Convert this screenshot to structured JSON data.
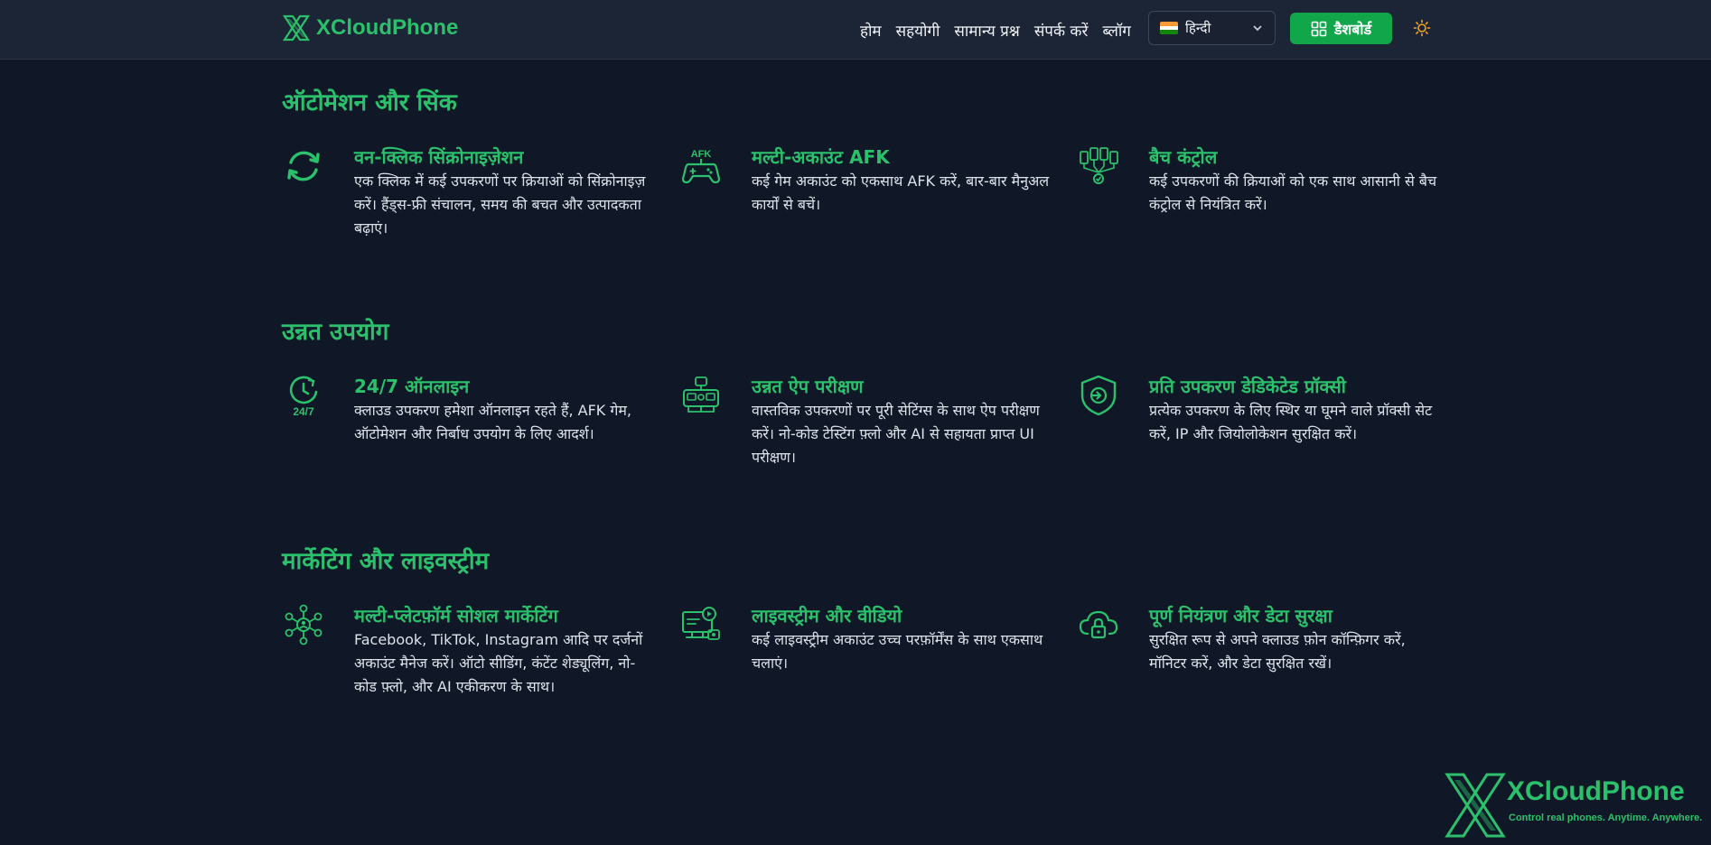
{
  "brand": {
    "name": "XCloudPhone",
    "color": "#2bc06b"
  },
  "nav": {
    "links": [
      "होम",
      "सहयोगी",
      "सामान्य प्रश्न",
      "संपर्क करें",
      "ब्लॉग"
    ],
    "language": "हिन्दी",
    "dashboard_label": "डैशबोर्ड",
    "theme_icon": "sun-icon"
  },
  "sections": [
    {
      "title": "ऑटोमेशन और सिंक",
      "features": [
        {
          "icon": "sync-icon",
          "title": "वन-क्लिक सिंक्रोनाइज़ेशन",
          "desc": "एक क्लिक में कई उपकरणों पर क्रियाओं को सिंक्रोनाइज़ करें। हैंड्स-फ्री संचालन, समय की बचत और उत्पादकता बढ़ाएं।"
        },
        {
          "icon": "gamepad-afk-icon",
          "icon_text": "AFK",
          "title": "मल्टी-अकाउंट AFK",
          "desc": "कई गेम अकाउंट को एकसाथ AFK करें, बार-बार मैनुअल कार्यों से बचें।"
        },
        {
          "icon": "batch-control-icon",
          "title": "बैच कंट्रोल",
          "desc": "कई उपकरणों की क्रियाओं को एक साथ आसानी से बैच कंट्रोल से नियंत्रित करें।"
        }
      ]
    },
    {
      "title": "उन्नत उपयोग",
      "features": [
        {
          "icon": "clock-24-7-icon",
          "icon_text": "24/7",
          "title": "24/7 ऑनलाइन",
          "desc": "क्लाउड उपकरण हमेशा ऑनलाइन रहते हैं, AFK गेम, ऑटोमेशन और निर्बाध उपयोग के लिए आदर्श।"
        },
        {
          "icon": "app-testing-icon",
          "title": "उन्नत ऐप परीक्षण",
          "desc": "वास्तविक उपकरणों पर पूरी सेटिंग्स के साथ ऐप परीक्षण करें। नो-कोड टेस्टिंग फ़्लो और AI से सहायता प्राप्त UI परीक्षण।"
        },
        {
          "icon": "shield-proxy-icon",
          "title": "प्रति उपकरण डेडिकेटेड प्रॉक्सी",
          "desc": "प्रत्येक उपकरण के लिए स्थिर या घूमने वाले प्रॉक्सी सेट करें, IP और जियोलोकेशन सुरक्षित करें।"
        }
      ]
    },
    {
      "title": "मार्केटिंग और लाइवस्ट्रीम",
      "features": [
        {
          "icon": "social-network-icon",
          "title": "मल्टी-प्लेटफ़ॉर्म सोशल मार्केटिंग",
          "desc": "Facebook, TikTok, Instagram आदि पर दर्जनों अकाउंट मैनेज करें। ऑटो सीडिंग, कंटेंट शेड्यूलिंग, नो-कोड फ़्लो, और AI एकीकरण के साथ।"
        },
        {
          "icon": "livestream-icon",
          "title": "लाइवस्ट्रीम और वीडियो",
          "desc": "कई लाइवस्ट्रीम अकाउंट उच्च परफ़ॉर्मेंस के साथ एकसाथ चलाएं।"
        },
        {
          "icon": "cloud-lock-icon",
          "title": "पूर्ण नियंत्रण और डेटा सुरक्षा",
          "desc": "सुरक्षित रूप से अपने क्लाउड फ़ोन कॉन्फ़िगर करें, मॉनिटर करें, और डेटा सुरक्षित रखें।"
        }
      ]
    }
  ],
  "watermark": {
    "name": "XCloudPhone",
    "tagline": "Control real phones. Anytime. Anywhere."
  }
}
